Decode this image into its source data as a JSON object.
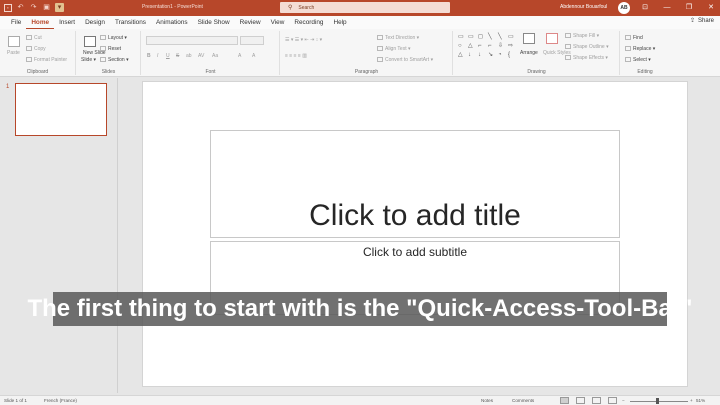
{
  "titlebar": {
    "doc_title": "Presentation1  -  PowerPoint",
    "search_placeholder": "Search",
    "user_name": "Abdennour Bouarfoul",
    "user_initials": "AB",
    "qat": {
      "save_icon": "save-icon",
      "undo_icon": "undo-icon",
      "redo_icon": "redo-icon",
      "present_icon": "present-icon",
      "customize_icon": "customize-qat-icon"
    },
    "controls": {
      "ribbon_display": "⊡",
      "minimize": "—",
      "restore": "❐",
      "close": "✕"
    },
    "colors": {
      "accent": "#b7472a",
      "qat_highlight": "#e2c290"
    }
  },
  "tabs": {
    "items": [
      "File",
      "Home",
      "Insert",
      "Design",
      "Transitions",
      "Animations",
      "Slide Show",
      "Review",
      "View",
      "Recording",
      "Help"
    ],
    "active": "Home",
    "share_label": "Share"
  },
  "ribbon": {
    "clipboard": {
      "label": "Clipboard",
      "paste": "Paste",
      "cut": "Cut",
      "copy": "Copy",
      "format_painter": "Format Painter"
    },
    "slides": {
      "label": "Slides",
      "new_slide": "New Slide",
      "new_slide_line2": "Slide ▾",
      "layout": "Layout ▾",
      "reset": "Reset",
      "section": "Section ▾"
    },
    "font": {
      "label": "Font",
      "bold": "B",
      "italic": "I",
      "underline": "U",
      "strike": "S",
      "shadow": "ab",
      "spacing": "AV",
      "case": "Aa",
      "clear": "A",
      "highlight": "A",
      "color": "A"
    },
    "paragraph": {
      "label": "Paragraph",
      "text_direction": "Text Direction ▾",
      "align_text": "Align Text ▾",
      "convert_smartart": "Convert to SmartArt ▾"
    },
    "drawing": {
      "label": "Drawing",
      "arrange": "Arrange",
      "quick_styles": "Quick Styles",
      "shape_fill": "Shape Fill ▾",
      "shape_outline": "Shape Outline ▾",
      "shape_effects": "Shape Effects ▾",
      "shapes": [
        "▭",
        "▭",
        "◻",
        "╲",
        "╲",
        "▭",
        "○",
        "△",
        "⌐",
        "⌐",
        "⇩",
        "⇨",
        "△",
        "↓",
        "↓",
        "↘",
        "◔",
        "{",
        "{",
        "☆",
        "⤴",
        "⌒",
        "⌒",
        "╌"
      ]
    },
    "editing": {
      "label": "Editing",
      "find": "Find",
      "replace": "Replace ▾",
      "select": "Select ▾"
    }
  },
  "thumbnails": {
    "slide_number": "1"
  },
  "slide": {
    "title_placeholder": "Click to add title",
    "subtitle_placeholder": "Click to add subtitle"
  },
  "caption": {
    "text": "The first thing to start with is the \"Quick-Access-Tool-Bar\""
  },
  "status": {
    "slide_info": "Slide 1 of 1",
    "language": "French (France)",
    "notes": "Notes",
    "comments": "Comments",
    "zoom": "51%"
  }
}
